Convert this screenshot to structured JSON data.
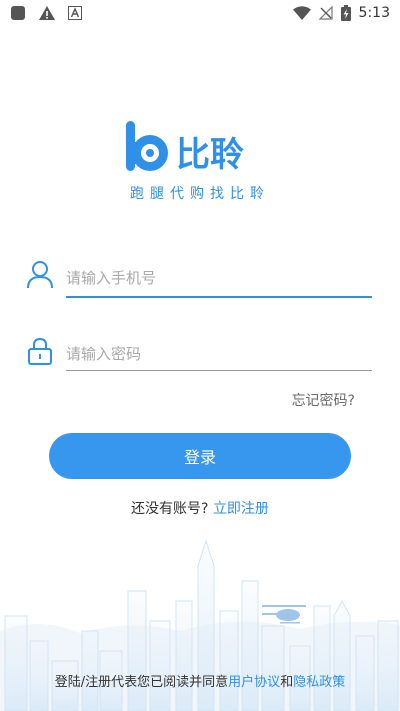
{
  "status_bar": {
    "time": "5:13",
    "left_icons": [
      "app-square-icon",
      "warning-icon",
      "font-a-icon"
    ],
    "right_icons": [
      "wifi-icon",
      "no-signal-icon",
      "battery-charging-icon"
    ]
  },
  "brand": {
    "name": "比聆",
    "slogan": "跑腿代购找比聆",
    "color": "#2f90e8"
  },
  "form": {
    "phone_placeholder": "请输入手机号",
    "password_placeholder": "请输入密码",
    "forgot_label": "忘记密码?",
    "login_label": "登录"
  },
  "register": {
    "prompt": "还没有账号?",
    "link": "立即注册"
  },
  "agreement": {
    "prefix": "登陆/注册代表您已阅读并同意",
    "user_agreement": "用户协议",
    "conjunction": "和",
    "privacy_policy": "隐私政策"
  },
  "colors": {
    "accent": "#2f90e8",
    "button": "#3797ee",
    "placeholder": "#a8a8a8"
  }
}
